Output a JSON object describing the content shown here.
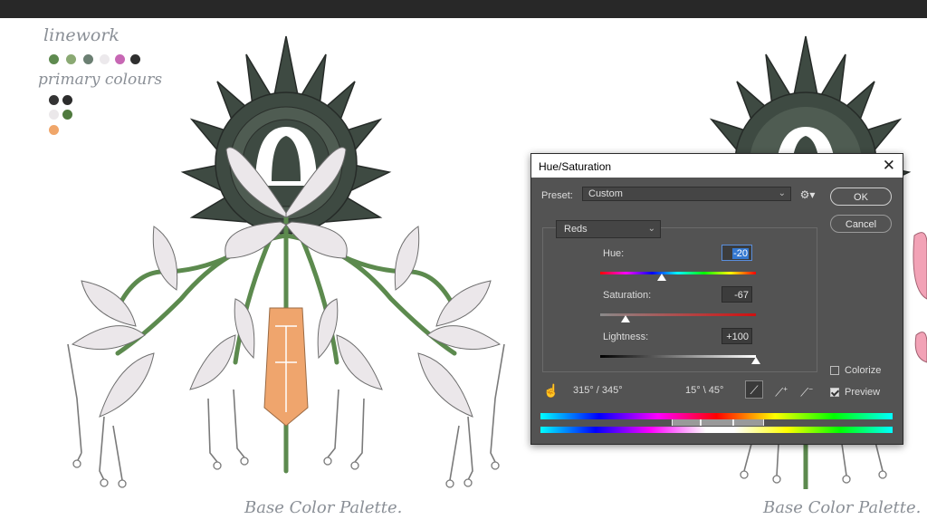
{
  "canvas": {
    "notes": {
      "linework": "linework",
      "primary": "primary colours",
      "caption": "Base Color Palette."
    },
    "swatches": {
      "linework": [
        "#5e8a4f",
        "#8aa973",
        "#6b7f72",
        "#ece9ec",
        "#c767b4",
        "#2f2f2f"
      ],
      "primary": [
        "#343434",
        "#2c2c2c",
        "#ebe8ea",
        "#4f7a3e",
        "#f0a66a"
      ]
    }
  },
  "dialog": {
    "title": "Hue/Saturation",
    "close": "✕",
    "preset_label": "Preset:",
    "preset_value": "Custom",
    "channel": "Reds",
    "ok": "OK",
    "cancel": "Cancel",
    "hue": {
      "label": "Hue:",
      "value": "-20",
      "fraction": 0.444
    },
    "saturation": {
      "label": "Saturation:",
      "value": "-67",
      "fraction": 0.165
    },
    "lightness": {
      "label": "Lightness:",
      "value": "+100",
      "fraction": 1.0
    },
    "colorize": {
      "label": "Colorize",
      "checked": false
    },
    "preview": {
      "label": "Preview",
      "checked": true
    },
    "range_left": "315° / 345°",
    "range_right": "15° \\ 45°",
    "icons": {
      "hand": "hand-tool-icon",
      "eyedropper": "eyedropper-icon",
      "eyedropper_add": "eyedropper-plus-icon",
      "eyedropper_sub": "eyedropper-minus-icon",
      "gear": "gear-icon"
    },
    "colors": {
      "panel": "#535353",
      "field": "#3c3c3c",
      "selection": "#3478d0"
    }
  }
}
